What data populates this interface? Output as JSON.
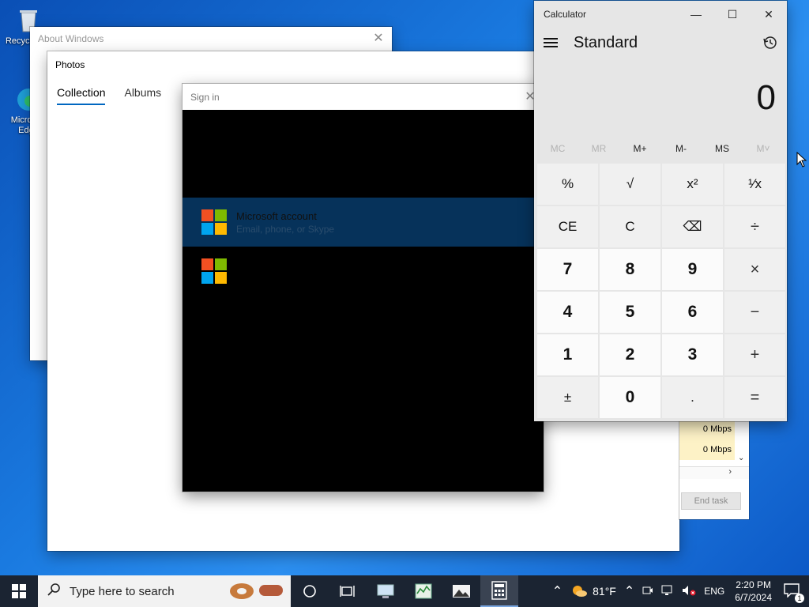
{
  "desktop": {
    "icons": [
      {
        "label": "Recycle Bin"
      },
      {
        "label": "Microsoft Edge"
      }
    ]
  },
  "about_window": {
    "title": "About Windows"
  },
  "photos_window": {
    "title": "Photos",
    "tabs": [
      {
        "label": "Collection",
        "active": true
      },
      {
        "label": "Albums",
        "active": false
      }
    ]
  },
  "signin_dialog": {
    "title": "Sign in",
    "accounts": [
      {
        "name": "Microsoft account",
        "detail": "Email, phone, or Skype",
        "selected": true
      },
      {
        "name": "",
        "detail": "",
        "selected": false
      }
    ]
  },
  "task_manager": {
    "cells": [
      "0 Mbps",
      "0 Mbps"
    ],
    "end_task_label": "End task"
  },
  "calculator": {
    "title": "Calculator",
    "mode": "Standard",
    "display": "0",
    "memory": [
      {
        "label": "MC",
        "enabled": false
      },
      {
        "label": "MR",
        "enabled": false
      },
      {
        "label": "M+",
        "enabled": true
      },
      {
        "label": "M-",
        "enabled": true
      },
      {
        "label": "MS",
        "enabled": true
      },
      {
        "label": "M˅",
        "enabled": false
      }
    ],
    "keys": [
      {
        "label": "%",
        "kind": "fn",
        "name": "percent-key"
      },
      {
        "label": "√",
        "kind": "fn",
        "name": "sqrt-key"
      },
      {
        "label": "x²",
        "kind": "fn",
        "name": "square-key"
      },
      {
        "label": "¹⁄x",
        "kind": "fn",
        "name": "reciprocal-key"
      },
      {
        "label": "CE",
        "kind": "fn",
        "name": "clear-entry-key"
      },
      {
        "label": "C",
        "kind": "fn",
        "name": "clear-key"
      },
      {
        "label": "⌫",
        "kind": "fn",
        "name": "backspace-key"
      },
      {
        "label": "÷",
        "kind": "op",
        "name": "divide-key"
      },
      {
        "label": "7",
        "kind": "num",
        "name": "digit-7-key"
      },
      {
        "label": "8",
        "kind": "num",
        "name": "digit-8-key"
      },
      {
        "label": "9",
        "kind": "num",
        "name": "digit-9-key"
      },
      {
        "label": "×",
        "kind": "op",
        "name": "multiply-key"
      },
      {
        "label": "4",
        "kind": "num",
        "name": "digit-4-key"
      },
      {
        "label": "5",
        "kind": "num",
        "name": "digit-5-key"
      },
      {
        "label": "6",
        "kind": "num",
        "name": "digit-6-key"
      },
      {
        "label": "−",
        "kind": "op",
        "name": "subtract-key"
      },
      {
        "label": "1",
        "kind": "num",
        "name": "digit-1-key"
      },
      {
        "label": "2",
        "kind": "num",
        "name": "digit-2-key"
      },
      {
        "label": "3",
        "kind": "num",
        "name": "digit-3-key"
      },
      {
        "label": "+",
        "kind": "op",
        "name": "add-key"
      },
      {
        "label": "±",
        "kind": "fn",
        "name": "negate-key"
      },
      {
        "label": "0",
        "kind": "num",
        "name": "digit-0-key"
      },
      {
        "label": ".",
        "kind": "fn",
        "name": "decimal-key"
      },
      {
        "label": "=",
        "kind": "op",
        "name": "equals-key"
      }
    ]
  },
  "taskbar": {
    "search_placeholder": "Type here to search",
    "weather": "81°F",
    "language": "ENG",
    "time": "2:20 PM",
    "date": "6/7/2024",
    "notification_count": "1"
  },
  "colors": {
    "accent": "#0067c0",
    "taskbar_bg": "#1b2432",
    "selected_account_bg": "#06325a"
  }
}
